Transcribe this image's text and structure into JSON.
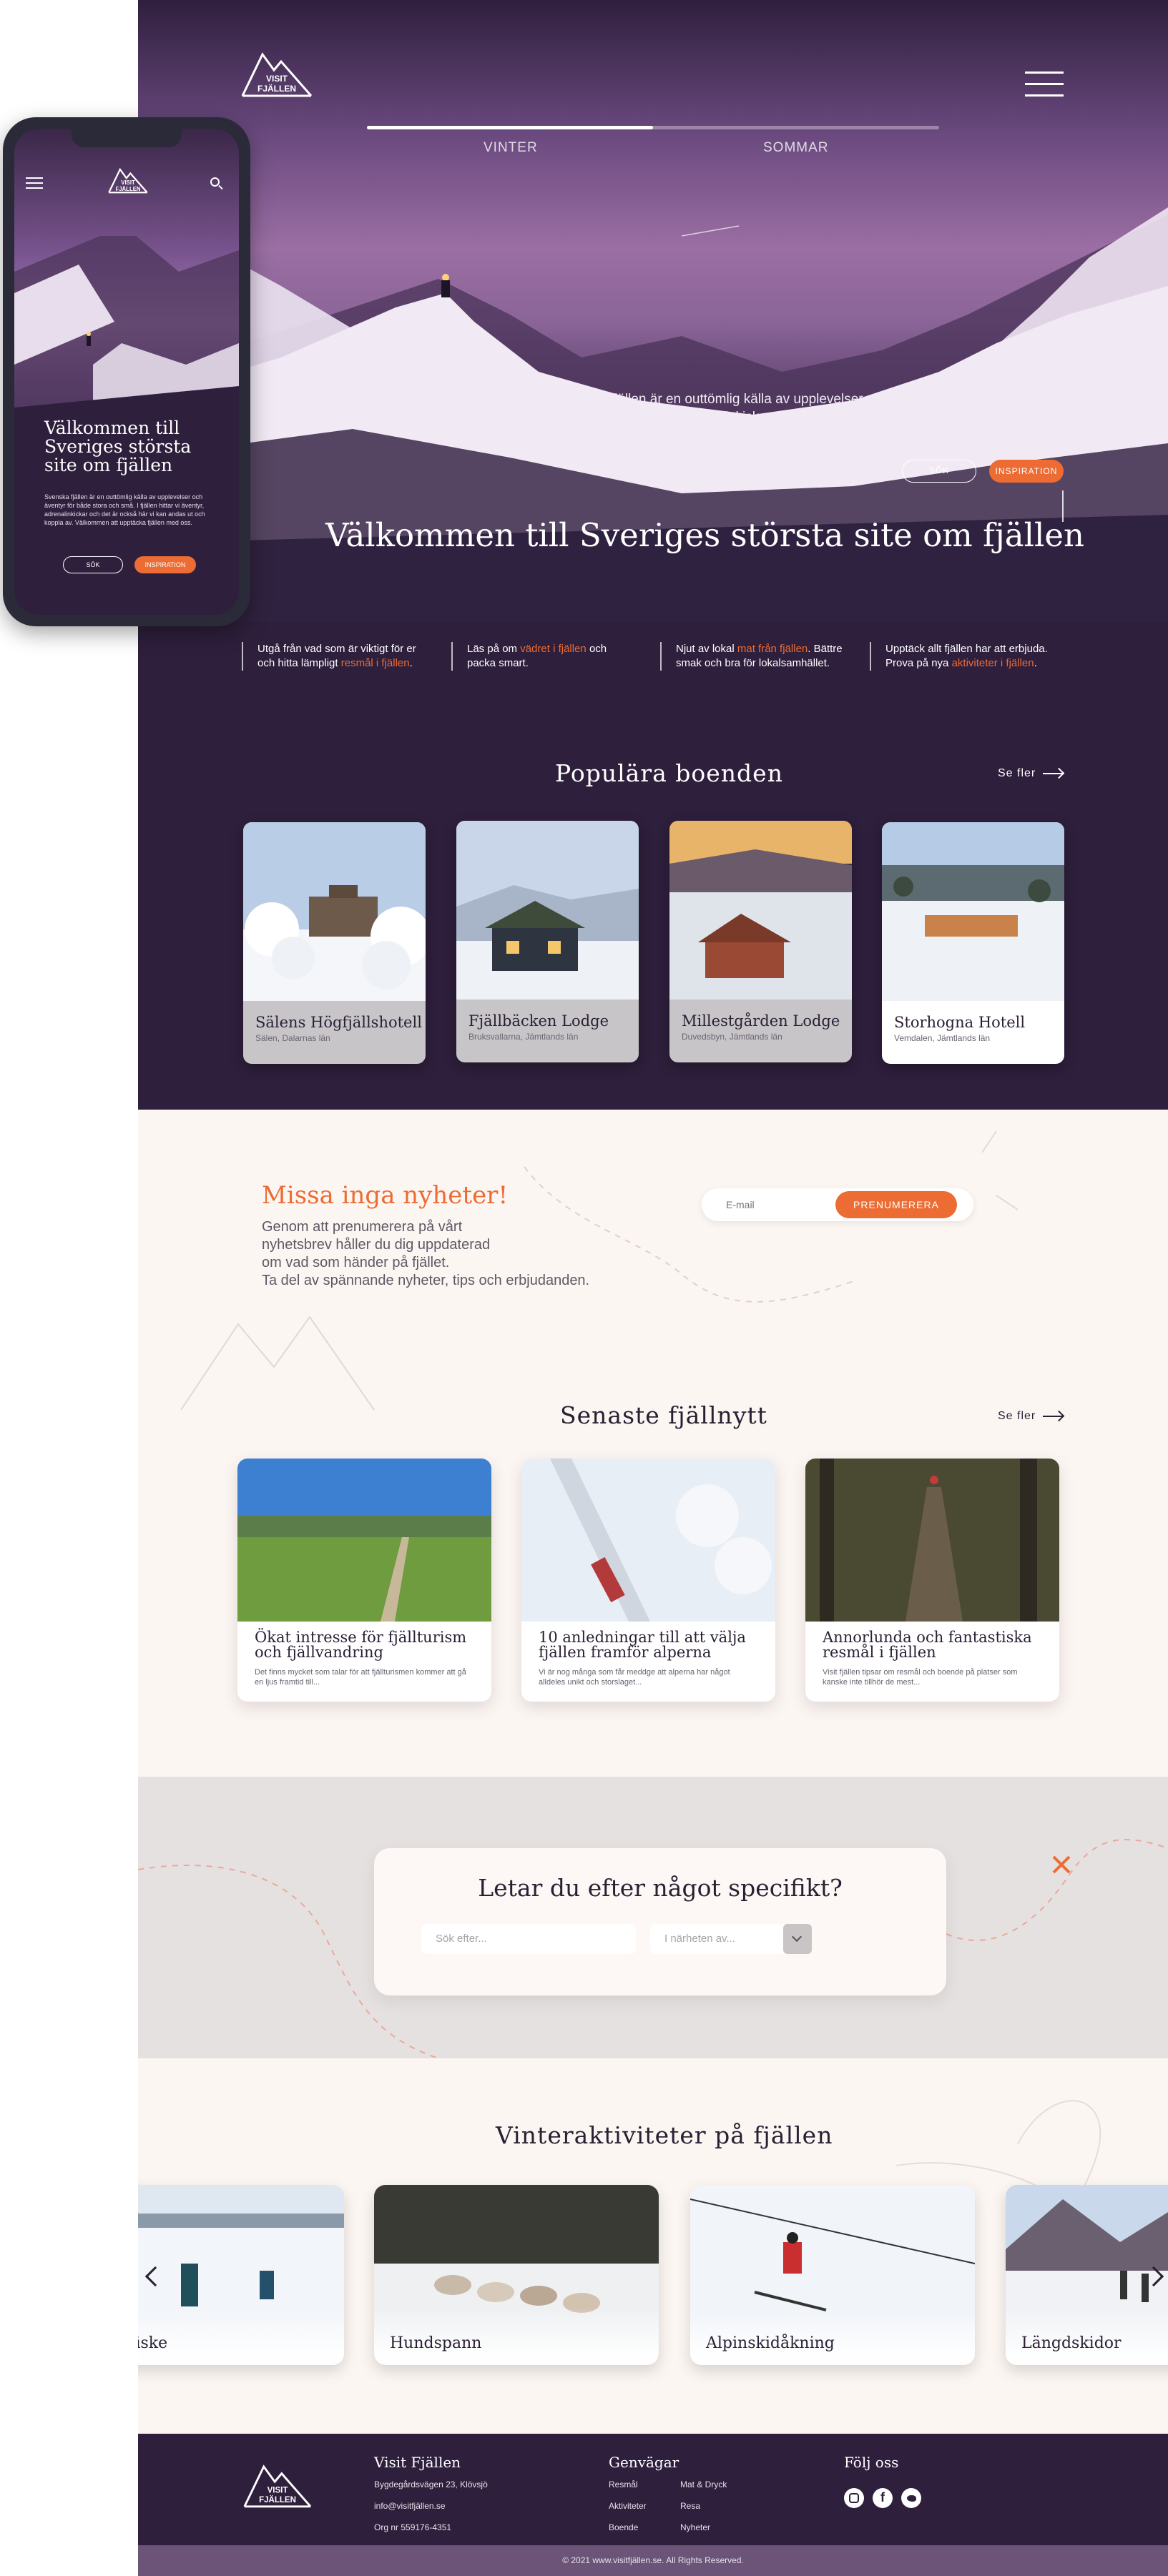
{
  "brand": {
    "logo_text_1": "VISIT",
    "logo_text_2": "FJÄLLEN",
    "accent": "#ec6c34",
    "dark": "#2e1f3c"
  },
  "hero": {
    "tabs": [
      {
        "label": "VINTER",
        "active": true
      },
      {
        "label": "SOMMAR",
        "active": false
      }
    ],
    "intro_line_1": "Svenska fjällen är en outtömlig källa av upplevelser och äventyr för både stora och små.",
    "intro_line_2": "I fjällen hittar vi äventyr, adrenalinkickar och det är också här vi kan andas ut och koppla av.",
    "intro_line_3": "Välkommen att upptäcka fjällen med oss.",
    "search_button": "SÖK",
    "inspiration_button": "INSPIRATION",
    "title": "Välkommen till Sveriges största site om fjällen"
  },
  "info": [
    {
      "pre": "Utgå från vad som är viktigt för er och hitta lämpligt ",
      "link": "resmål i fjällen",
      "post": "."
    },
    {
      "pre": "Läs på om ",
      "link": "vädret i fjällen",
      "post": " och packa smart."
    },
    {
      "pre": "Njut av lokal ",
      "link": "mat från fjällen",
      "post": ". Bättre smak och bra för lokalsamhället."
    },
    {
      "pre": "Upptäck allt fjällen har att erbjuda. Prova på nya ",
      "link": "aktiviteter i fjällen",
      "post": "."
    }
  ],
  "accommodations": {
    "title": "Populära boenden",
    "see_more": "Se fler",
    "items": [
      {
        "name": "Sälens Högfjällshotell",
        "location": "Sälen, Dalarnas län"
      },
      {
        "name": "Fjällbäcken Lodge",
        "location": "Bruksvallarna, Jämtlands län"
      },
      {
        "name": "Millestgården Lodge",
        "location": "Duvedsbyn, Jämtlands län"
      },
      {
        "name": "Storhogna Hotell",
        "location": "Vemdalen, Jämtlands län"
      }
    ]
  },
  "newsletter": {
    "title": "Missa inga nyheter!",
    "text_1": "Genom att prenumerera på vårt",
    "text_2": "nyhetsbrev håller du dig uppdaterad",
    "text_3": "om vad som händer på fjället.",
    "text_4": "Ta del av spännande nyheter, tips och erbjudanden.",
    "email_placeholder": "E-mail",
    "subscribe_button": "PRENUMERERA"
  },
  "news": {
    "title": "Senaste fjällnytt",
    "see_more": "Se fler",
    "items": [
      {
        "title": "Ökat intresse för fjällturism och fjällvandring",
        "excerpt": "Det finns mycket som talar för att fjällturismen kommer att gå en ljus framtid till..."
      },
      {
        "title": "10 anledningar till att välja fjällen framför alperna",
        "excerpt": "Vi är nog många som får meddge att alperna har något alldeles unikt och storslaget..."
      },
      {
        "title": "Annorlunda och fantastiska resmål i fjällen",
        "excerpt": "Visit fjällen tipsar om resmål och boende på platser som kanske inte tillhör de mest..."
      }
    ]
  },
  "search": {
    "title": "Letar du efter något specifikt?",
    "query_placeholder": "Sök efter...",
    "near_placeholder": "I närheten av..."
  },
  "activities": {
    "title": "Vinteraktiviteter på fjällen",
    "items": [
      {
        "label": "Pimpelfiske"
      },
      {
        "label": "Hundspann"
      },
      {
        "label": "Alpinskidåkning"
      },
      {
        "label": "Längdskidor"
      }
    ]
  },
  "footer": {
    "col1_title": "Visit Fjällen",
    "address": "Bygdegårdsvägen 23, Klövsjö",
    "email": "info@visitfjällen.se",
    "org": "Org nr 559176-4351",
    "col2_title": "Genvägar",
    "links": [
      "Resmål",
      "Mat & Dryck",
      "Aktiviteter",
      "Resa",
      "Boende",
      "Nyheter"
    ],
    "col3_title": "Följ oss",
    "copyright": "© 2021 www.visitfjällen.se. All Rights Reserved."
  },
  "mobile": {
    "title": "Välkommen till Sveriges största site om fjällen",
    "text": "Svenska fjällen är en outtömlig källa av upplevelser och äventyr för både stora och små. I fjällen hittar vi äventyr, adrenalinkickar och det är också här vi kan andas ut och koppla av. Välkommen att upptäcka fjällen med oss.",
    "search_button": "SÖK",
    "inspiration_button": "INSPIRATION"
  }
}
